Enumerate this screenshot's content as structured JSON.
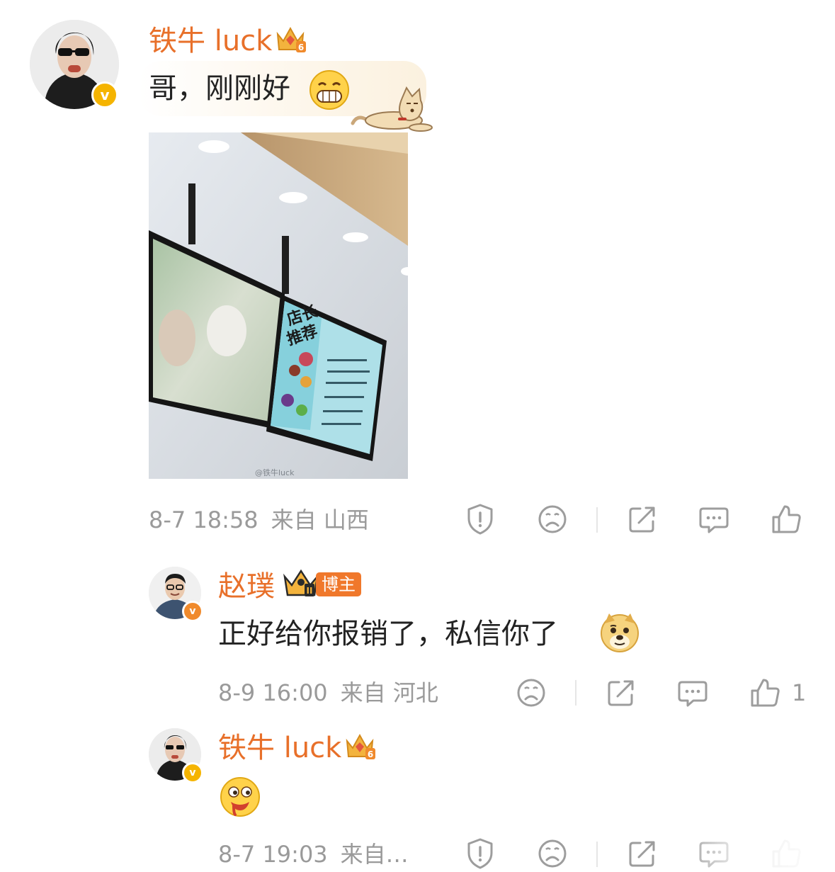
{
  "comment1": {
    "username": "铁牛 luck",
    "verified_badge": "v",
    "crown_level": "6",
    "text": "哥，刚刚好",
    "emoji": "grin-emoji",
    "photo": {
      "menu_title_line1": "店长",
      "menu_title_line2": "推荐",
      "watermark": "@铁牛luck"
    },
    "timestamp": "8-7 18:58",
    "source": "来自 山西"
  },
  "reply1": {
    "username": "赵璞",
    "verified_badge": "v",
    "crown_level": "II",
    "role_badge": "博主",
    "text": "正好给你报销了，私信你了",
    "emoji": "doge-emoji",
    "timestamp": "8-9 16:00",
    "source": "来自 河北",
    "like_count": "1"
  },
  "reply2": {
    "username": "铁牛 luck",
    "verified_badge": "v",
    "crown_level": "6",
    "emoji": "drool-emoji",
    "timestamp": "8-7 19:03",
    "source": "来自…"
  },
  "colors": {
    "name_orange": "#e8702a",
    "meta_gray": "#9a9a9a",
    "icon_gray": "#9d9d9d",
    "verified_gold": "#f5b400"
  }
}
